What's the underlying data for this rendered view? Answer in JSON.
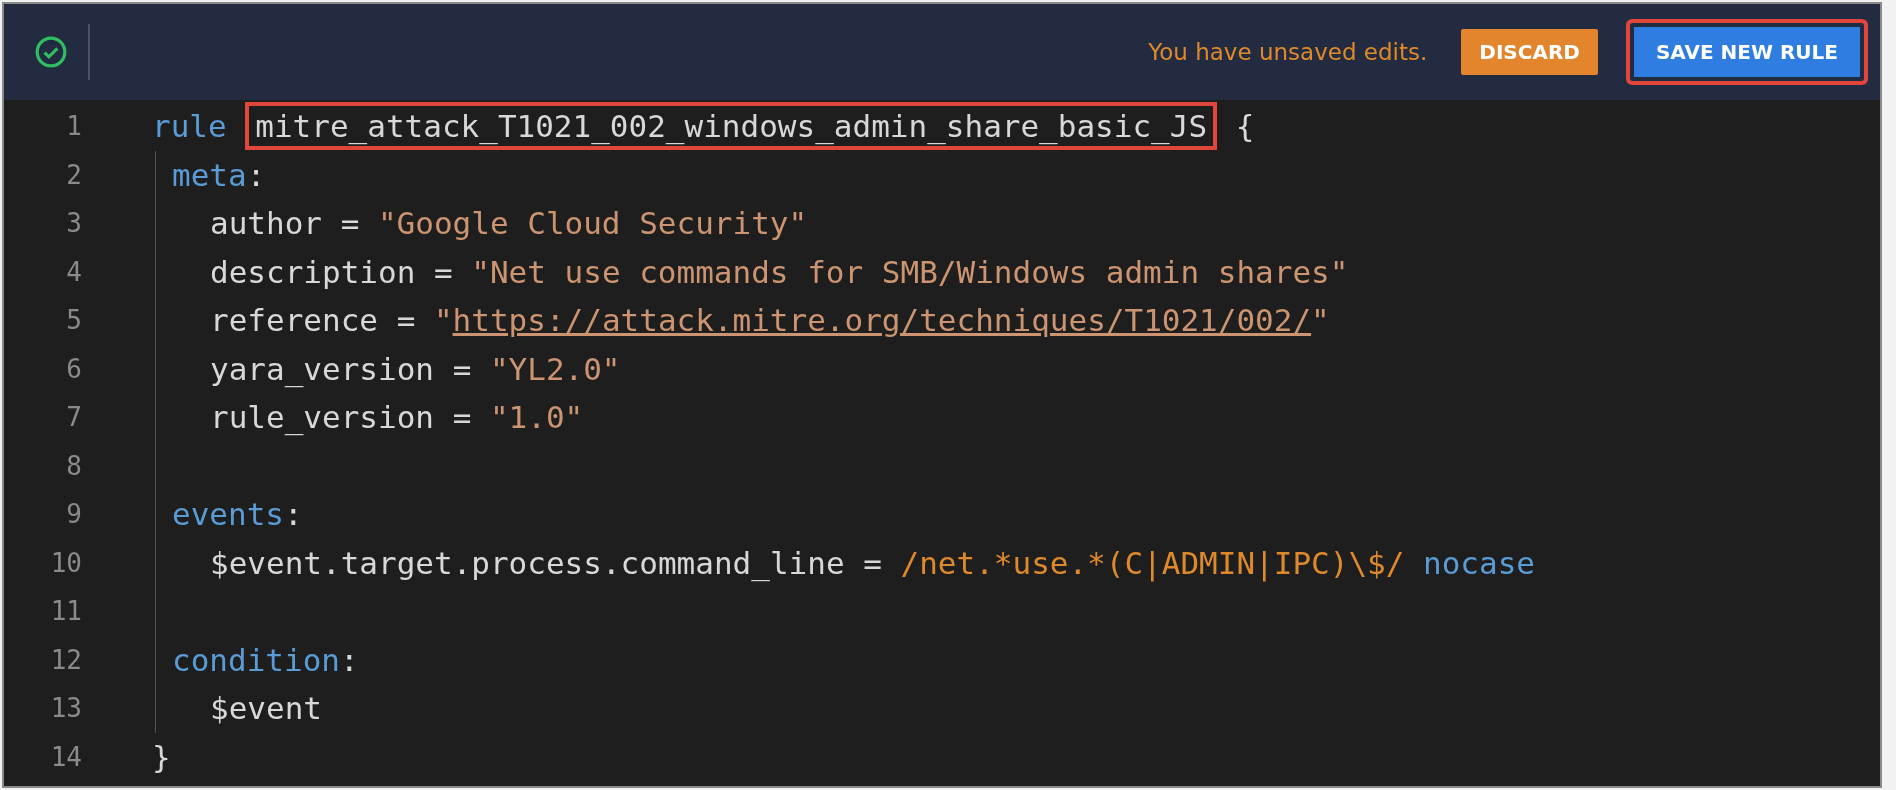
{
  "toolbar": {
    "message": "You have unsaved edits.",
    "buttons": [
      {
        "label": "DISCARD",
        "kind": "secondary",
        "highlighted": false
      },
      {
        "label": "SAVE NEW RULE",
        "kind": "primary",
        "highlighted": true
      }
    ]
  },
  "editor": {
    "lines": [
      {
        "number": "1",
        "kind": "top",
        "tokens": [
          {
            "text": "rule",
            "kind": "keyword"
          },
          {
            "text": "mitre_attack_T1021_002_windows_admin_share_basic_JS",
            "kind": "plain",
            "highlighted": true
          },
          {
            "text": "{",
            "kind": "plain"
          }
        ]
      },
      {
        "number": "2",
        "kind": "section",
        "tokens": [
          {
            "text": "meta",
            "kind": "keyword"
          },
          {
            "text": ":",
            "kind": "plain"
          }
        ]
      },
      {
        "number": "3",
        "kind": "entry",
        "tokens": [
          {
            "text": "author =",
            "kind": "plain"
          },
          {
            "text": "\"Google Cloud Security\"",
            "kind": "string"
          }
        ]
      },
      {
        "number": "4",
        "kind": "entry",
        "tokens": [
          {
            "text": "description =",
            "kind": "plain"
          },
          {
            "text": "\"Net use commands for SMB/Windows admin shares\"",
            "kind": "string"
          }
        ]
      },
      {
        "number": "5",
        "kind": "entry",
        "tokens": [
          {
            "text": "reference =",
            "kind": "plain"
          },
          {
            "text": "\"",
            "kind": "string"
          },
          {
            "text": "https://attack.mitre.org/techniques/T1021/002/",
            "kind": "link"
          },
          {
            "text": "\"",
            "kind": "string"
          }
        ]
      },
      {
        "number": "6",
        "kind": "entry",
        "tokens": [
          {
            "text": "yara_version =",
            "kind": "plain"
          },
          {
            "text": "\"YL2.0\"",
            "kind": "string"
          }
        ]
      },
      {
        "number": "7",
        "kind": "entry",
        "tokens": [
          {
            "text": "rule_version =",
            "kind": "plain"
          },
          {
            "text": "\"1.0\"",
            "kind": "string"
          }
        ]
      },
      {
        "number": "8",
        "kind": "blank"
      },
      {
        "number": "9",
        "kind": "section",
        "tokens": [
          {
            "text": "events",
            "kind": "keyword"
          },
          {
            "text": ":",
            "kind": "plain"
          }
        ]
      },
      {
        "number": "10",
        "kind": "entry",
        "tokens": [
          {
            "text": "$event.target.process.command_line =",
            "kind": "plain"
          },
          {
            "text": "/net.*use.*(C|ADMIN|IPC)\\$/",
            "kind": "regex"
          },
          {
            "text": "nocase",
            "kind": "keyword"
          }
        ]
      },
      {
        "number": "11",
        "kind": "blank"
      },
      {
        "number": "12",
        "kind": "section",
        "tokens": [
          {
            "text": "condition",
            "kind": "keyword"
          },
          {
            "text": ":",
            "kind": "plain"
          }
        ]
      },
      {
        "number": "13",
        "kind": "entry",
        "tokens": [
          {
            "text": "$event",
            "kind": "plain"
          }
        ]
      },
      {
        "number": "14",
        "kind": "top",
        "tokens": [
          {
            "text": "}",
            "kind": "plain"
          }
        ]
      }
    ]
  }
}
